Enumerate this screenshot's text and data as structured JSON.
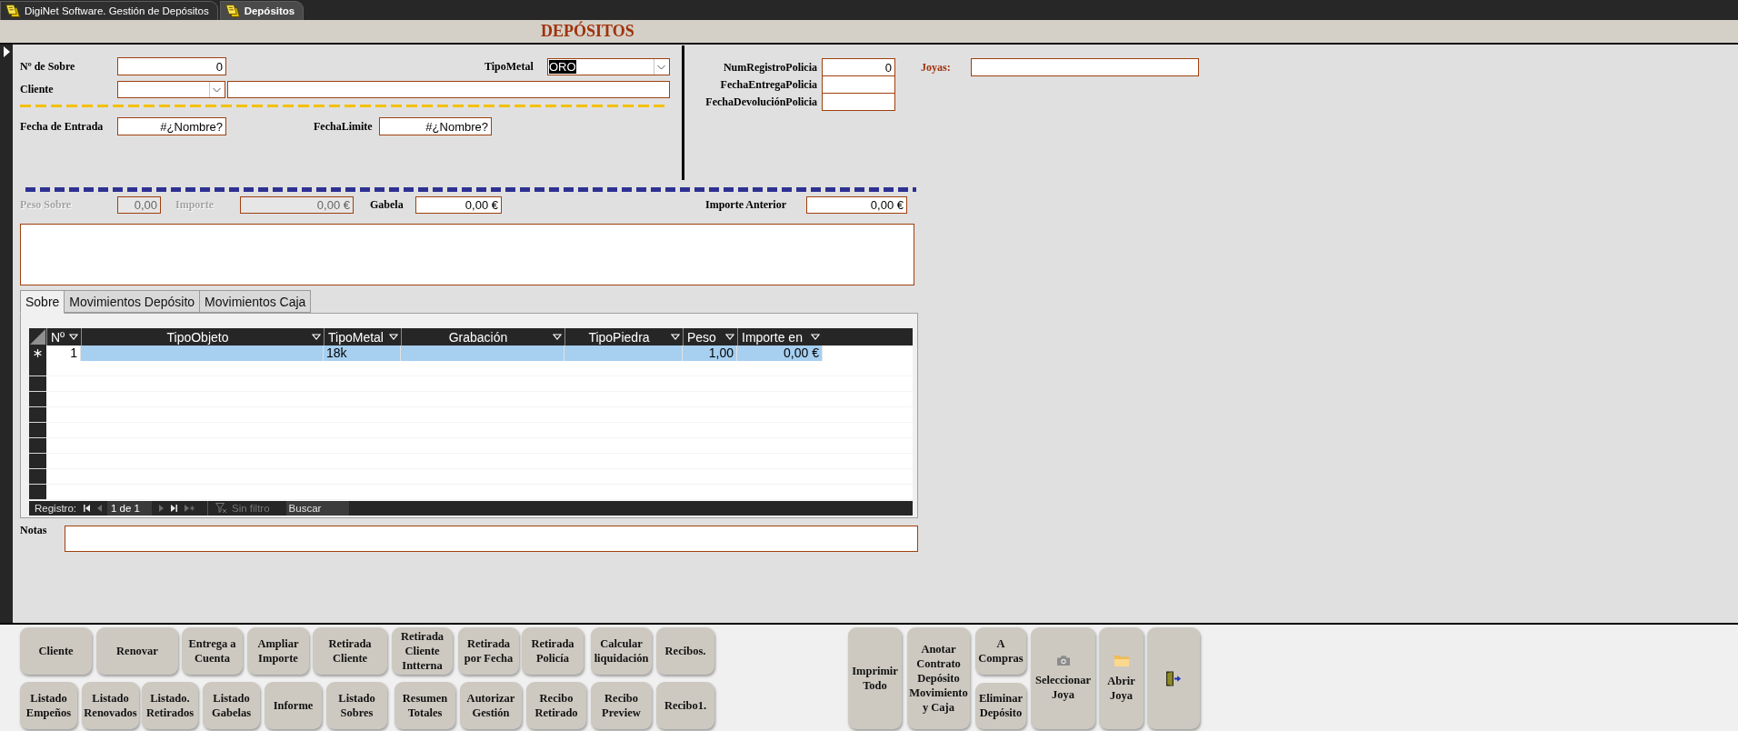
{
  "doc_tabs": [
    {
      "label": "DigiNet Software. Gestión de Depósitos",
      "selected": false
    },
    {
      "label": "Depósitos",
      "selected": true
    }
  ],
  "header": {
    "title": "DEPÓSITOS"
  },
  "form": {
    "sobre": {
      "label": "Nº de Sobre",
      "value": "0"
    },
    "tipo_metal": {
      "label": "TipoMetal",
      "value": "ORO",
      "value_selected": true
    },
    "cliente": {
      "label": "Cliente"
    },
    "fecha_entrada": {
      "label": "Fecha de Entrada",
      "value": "#¿Nombre?"
    },
    "fecha_limite": {
      "label": "FechaLimite",
      "value": "#¿Nombre?"
    },
    "policia": [
      {
        "label": "NumRegistroPolicia",
        "value": "0"
      },
      {
        "label": "FechaEntregaPolicia"
      },
      {
        "label": "FechaDevoluciónPolicia"
      }
    ],
    "joyas": {
      "label": "Joyas:"
    },
    "amounts": [
      {
        "label": "Peso Sobre",
        "value": "0,00",
        "disabled": true
      },
      {
        "label": "Importe",
        "value": "0,00 €",
        "disabled": true
      },
      {
        "label": "Gabela",
        "value": "0,00 €",
        "disabled": false
      },
      {
        "label": "Importe Anterior",
        "value": "0,00 €",
        "disabled": false
      }
    ]
  },
  "tabs": [
    {
      "label": "Sobre",
      "selected": true
    },
    {
      "label": "Movimientos Depósito",
      "selected": false
    },
    {
      "label": "Movimientos Caja",
      "selected": false
    }
  ],
  "grid": {
    "columns": [
      {
        "label": "Nº"
      },
      {
        "label": "TipoObjeto"
      },
      {
        "label": "TipoMetal"
      },
      {
        "label": "Grabación"
      },
      {
        "label": "TipoPiedra"
      },
      {
        "label": "Peso"
      },
      {
        "label": "Importe en"
      }
    ],
    "rows": [
      {
        "new_record": true,
        "selected": true,
        "cells": [
          {
            "text": "1",
            "focused": true
          },
          {
            "focused": false
          },
          {
            "text": "18k",
            "focused": false
          },
          {
            "focused": false
          },
          {
            "focused": false
          },
          {
            "text": "1,00",
            "focused": false
          },
          {
            "text": "0,00 €",
            "focused": false
          }
        ]
      }
    ],
    "navigation": {
      "label": "Registro:",
      "buttons": [
        {
          "kind": "first",
          "disabled": false
        },
        {
          "kind": "previous",
          "disabled": true
        },
        {
          "kind": "next",
          "disabled": true
        },
        {
          "kind": "last",
          "disabled": false
        },
        {
          "kind": "new",
          "disabled": true
        }
      ],
      "position": "1 de 1",
      "filter": {
        "label": "Sin filtro",
        "disabled": true
      },
      "search": {
        "placeholder": "Buscar"
      }
    }
  },
  "notas": {
    "label": "Notas"
  },
  "command_rows": [
    {
      "buttons": [
        {
          "label": "Cliente"
        },
        {
          "label": "Renovar"
        },
        {
          "label": "Entrega a\nCuenta"
        },
        {
          "label": "Ampliar\nImporte"
        },
        {
          "label": "Retirada\nCliente"
        },
        {
          "label": "Retirada\nCliente\nIntterna"
        },
        {
          "label": "Retirada\npor Fecha"
        },
        {
          "label": "Retirada\nPolicía"
        },
        {
          "label": "Calcular\nliquidación"
        },
        {
          "label": "Recibos."
        }
      ]
    },
    {
      "buttons": [
        {
          "label": "Listado\nEmpeños"
        },
        {
          "label": "Listado\nRenovados"
        },
        {
          "label": "Listado.\nRetirados"
        },
        {
          "label": "Listado\nGabelas"
        },
        {
          "label": "Informe"
        },
        {
          "label": "Listado\nSobres"
        },
        {
          "label": "Resumen\nTotales"
        },
        {
          "label": "Autorizar\nGestión"
        },
        {
          "label": "Recibo\nRetirado"
        },
        {
          "label": "Recibo\nPreview"
        },
        {
          "label": "Recibo1."
        }
      ]
    }
  ],
  "command_columns": [
    {
      "buttons": [
        {
          "kind": "text",
          "label": "Imprimir\nTodo"
        }
      ]
    },
    {
      "buttons": [
        {
          "kind": "text",
          "label": "Anotar\nContrato\nDepósito\nMovimiento\ny Caja"
        }
      ]
    },
    {
      "buttons": [
        {
          "kind": "text",
          "label": "A\nCompras"
        },
        {
          "kind": "text",
          "label": "Eliminar\nDepósito"
        }
      ]
    },
    {
      "buttons": [
        {
          "kind": "camera",
          "label": "Seleccionar\nJoya"
        }
      ]
    },
    {
      "buttons": [
        {
          "kind": "folder",
          "label": "Abrir\nJoya"
        }
      ]
    },
    {
      "buttons": [
        {
          "kind": "exit"
        }
      ]
    }
  ]
}
